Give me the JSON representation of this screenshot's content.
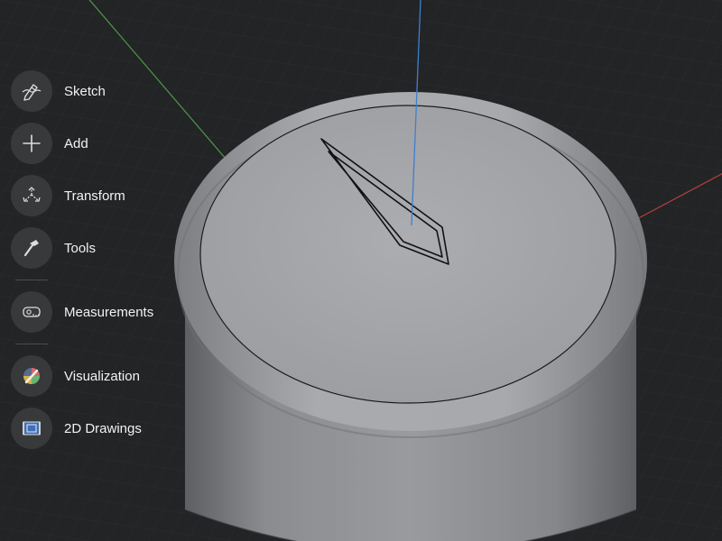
{
  "toolbar": {
    "items": [
      {
        "label": "Sketch",
        "icon": "pencil-sketch-icon"
      },
      {
        "label": "Add",
        "icon": "plus-icon"
      },
      {
        "label": "Transform",
        "icon": "transform-axes-icon"
      },
      {
        "label": "Tools",
        "icon": "hammer-icon"
      },
      {
        "label": "Measurements",
        "icon": "tape-measure-icon"
      },
      {
        "label": "Visualization",
        "icon": "paintbrush-palette-icon"
      },
      {
        "label": "2D Drawings",
        "icon": "blueprint-icon"
      }
    ]
  },
  "scene": {
    "background": "#222426",
    "axis_colors": {
      "x": "#b2423c",
      "y": "#4e9a46",
      "z": "#3f7fd0"
    },
    "model_color": "#a5a6aa"
  }
}
